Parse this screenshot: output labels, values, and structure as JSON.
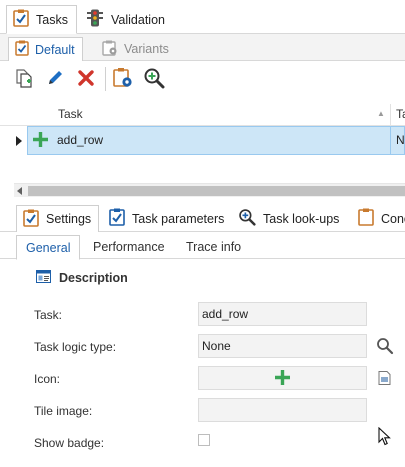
{
  "top_tabs": [
    {
      "label": "Tasks",
      "icon": "tasks-clipboard-icon",
      "active": true
    },
    {
      "label": "Validation",
      "icon": "traffic-light-icon",
      "active": false
    }
  ],
  "sub_tabs": [
    {
      "label": "Default",
      "icon": "clipboard-check-icon",
      "active": true
    },
    {
      "label": "Variants",
      "icon": "variants-gear-icon",
      "active": false
    }
  ],
  "toolbar": {
    "buttons": [
      {
        "name": "copy-button",
        "icon": "copy-icon"
      },
      {
        "name": "edit-button",
        "icon": "pencil-icon"
      },
      {
        "name": "delete-button",
        "icon": "delete-x-icon"
      },
      {
        "name": "task-settings-button",
        "icon": "clipboard-gear-icon"
      },
      {
        "name": "task-lookup-button",
        "icon": "magnifier-plus-icon"
      }
    ]
  },
  "grid": {
    "columns": [
      "Task",
      "Ta"
    ],
    "rows": [
      {
        "icon": "green-plus-icon",
        "task": "add_row",
        "col2": "No"
      }
    ]
  },
  "bottom_tabs": [
    {
      "label": "Settings",
      "icon": "clipboard-check-icon",
      "active": true
    },
    {
      "label": "Task parameters",
      "icon": "clipboard-check-blue-icon",
      "active": false
    },
    {
      "label": "Task look-ups",
      "icon": "magnifier-plus-icon",
      "active": false
    },
    {
      "label": "Conc",
      "icon": "clipboard-icon",
      "active": false
    }
  ],
  "inner_tabs": [
    {
      "label": "General",
      "active": true
    },
    {
      "label": "Performance",
      "active": false
    },
    {
      "label": "Trace info",
      "active": false
    }
  ],
  "description": {
    "title": "Description",
    "fields": {
      "task_label": "Task:",
      "task_value": "add_row",
      "logic_label": "Task logic type:",
      "logic_value": "None",
      "icon_label": "Icon:",
      "tile_label": "Tile image:",
      "badge_label": "Show badge:",
      "badge_checked": false
    }
  },
  "colors": {
    "selection": "#cde6f7",
    "accent_blue": "#1d5fa9",
    "green": "#3aa556",
    "red": "#d0352c"
  }
}
